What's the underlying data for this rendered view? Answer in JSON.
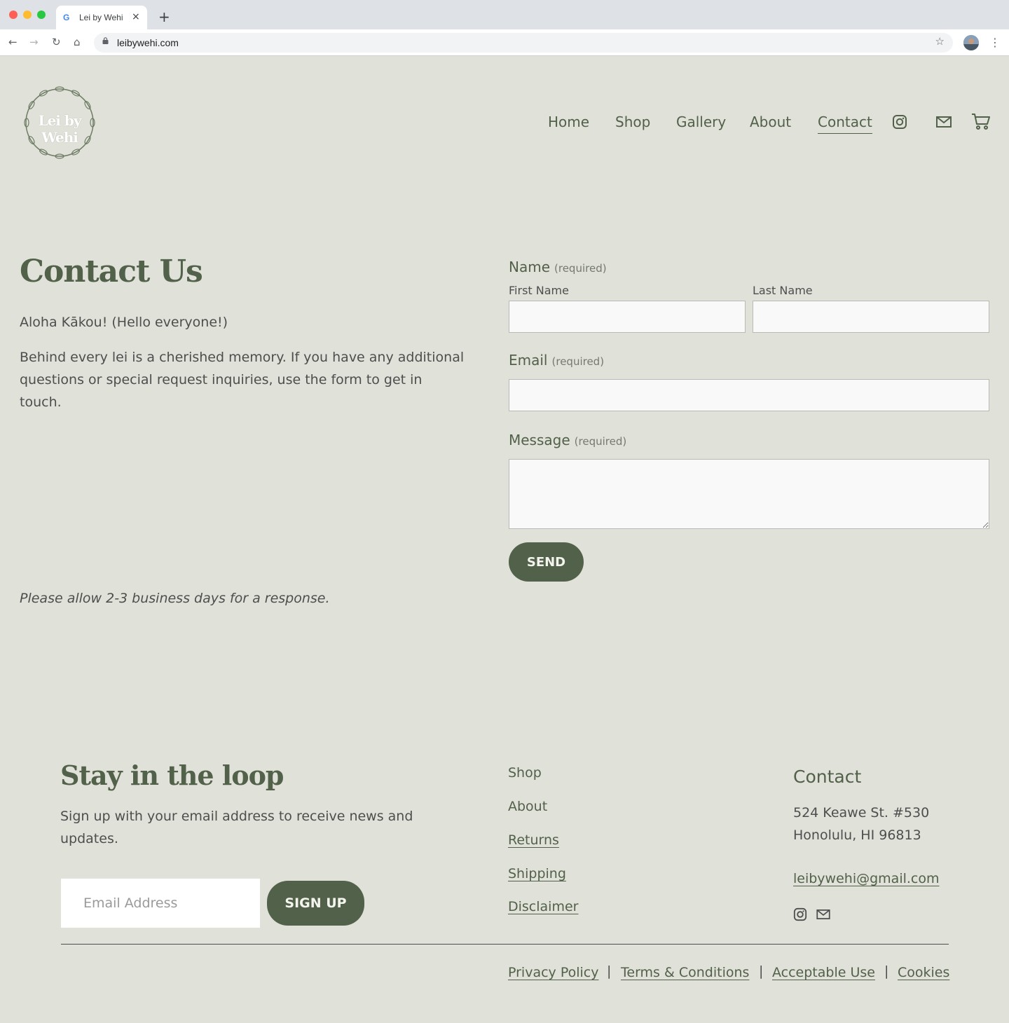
{
  "browser": {
    "tab_title": "Lei by Wehi",
    "url": "leibywehi.com",
    "new_tab_symbol": "+",
    "tab_close_symbol": "×"
  },
  "brand": {
    "logo_text": "Lei by Wehi",
    "accent_color": "#52614a",
    "background_color": "#e0e1d9"
  },
  "nav": {
    "items": [
      {
        "label": "Home"
      },
      {
        "label": "Shop"
      },
      {
        "label": "Gallery"
      },
      {
        "label": "About"
      },
      {
        "label": "Contact",
        "active": true
      }
    ],
    "icons": [
      "instagram-icon",
      "mail-icon",
      "cart-icon"
    ]
  },
  "contact": {
    "title": "Contact Us",
    "greeting": "Aloha Kākou! (Hello everyone!)",
    "description": "Behind every lei is a cherished memory. If you have any additional questions or special request inquiries, use the form to get in touch.",
    "note": "Please allow 2-3 business days for a response."
  },
  "form": {
    "name_label": "Name",
    "required_text": "(required)",
    "first_name_label": "First Name",
    "last_name_label": "Last Name",
    "email_label": "Email",
    "message_label": "Message",
    "send_label": "SEND"
  },
  "footer": {
    "title": "Stay in the loop",
    "text": "Sign up with your email address to receive news and updates.",
    "email_placeholder": "Email Address",
    "signup_label": "SIGN UP",
    "links": [
      {
        "label": "Shop"
      },
      {
        "label": "About"
      },
      {
        "label": "Returns"
      },
      {
        "label": "Shipping"
      },
      {
        "label": "Disclaimer"
      }
    ],
    "contact_title": "Contact",
    "address_line1": "524 Keawe St. #530",
    "address_line2": "Honolulu, HI 96813",
    "email": "leibywehi@gmail.com",
    "legal": [
      {
        "label": "Privacy Policy"
      },
      {
        "label": "Terms & Conditions"
      },
      {
        "label": "Acceptable Use"
      },
      {
        "label": "Cookies"
      }
    ],
    "legal_separator": "|"
  }
}
